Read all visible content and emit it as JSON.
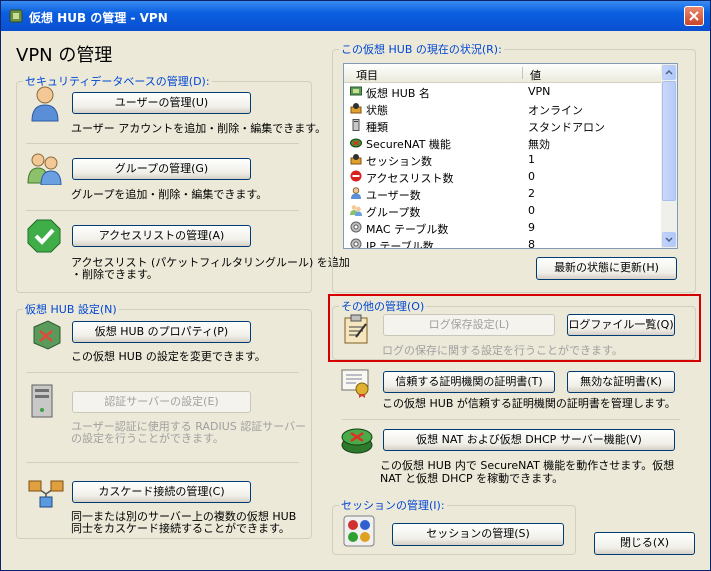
{
  "window": {
    "title": "仮想 HUB の管理 - VPN",
    "heading": "VPN の管理"
  },
  "security_db": {
    "legend": "セキュリティデータベースの管理(D):",
    "user_btn": "ユーザーの管理(U)",
    "user_desc": "ユーザー アカウントを追加・削除・編集できます。",
    "group_btn": "グループの管理(G)",
    "group_desc": "グループを追加・削除・編集できます。",
    "acl_btn": "アクセスリストの管理(A)",
    "acl_desc1": "アクセスリスト (パケットフィルタリングルール) を追加",
    "acl_desc2": "・削除できます。"
  },
  "hub_settings": {
    "legend": "仮想 HUB 設定(N)",
    "prop_btn": "仮想 HUB のプロパティ(P)",
    "prop_desc": "この仮想 HUB の設定を変更できます。",
    "radius_btn": "認証サーバーの設定(E)",
    "radius_desc1": "ユーザー認証に使用する RADIUS 認証サーバー",
    "radius_desc2": "の設定を行うことができます。",
    "cascade_btn": "カスケード接続の管理(C)",
    "cascade_desc1": "同一または別のサーバー上の複数の仮想 HUB",
    "cascade_desc2": "同士をカスケード接続することができます。"
  },
  "status": {
    "legend": "この仮想 HUB の現在の状況(R):",
    "col_item": "項目",
    "col_value": "値",
    "rows": [
      {
        "icon": "hub-icon",
        "item": "仮想 HUB 名",
        "value": "VPN"
      },
      {
        "icon": "status-icon",
        "item": "状態",
        "value": "オンライン"
      },
      {
        "icon": "server-type-icon",
        "item": "種類",
        "value": "スタンドアロン"
      },
      {
        "icon": "securenat-icon",
        "item": "SecureNAT 機能",
        "value": "無効"
      },
      {
        "icon": "session-icon",
        "item": "セッション数",
        "value": "1"
      },
      {
        "icon": "no-entry-icon",
        "item": "アクセスリスト数",
        "value": "0"
      },
      {
        "icon": "user-icon",
        "item": "ユーザー数",
        "value": "2"
      },
      {
        "icon": "group-icon",
        "item": "グループ数",
        "value": "0"
      },
      {
        "icon": "mac-table-icon",
        "item": "MAC テーブル数",
        "value": "9"
      },
      {
        "icon": "ip-table-icon",
        "item": "IP テーブル数",
        "value": "8"
      }
    ],
    "refresh_btn": "最新の状態に更新(H)"
  },
  "other": {
    "legend": "その他の管理(O)",
    "log_settings_btn": "ログ保存設定(L)",
    "log_list_btn": "ログファイル一覧(Q)",
    "log_desc": "ログの保存に関する設定を行うことができます。",
    "trusted_ca_btn": "信頼する証明機関の証明書(T)",
    "crl_btn": "無効な証明書(K)",
    "cert_desc": "この仮想 HUB が信頼する証明機関の証明書を管理します。",
    "nat_btn": "仮想 NAT および仮想 DHCP サーバー機能(V)",
    "nat_desc1": "この仮想 HUB 内で SecureNAT 機能を動作させます。仮想",
    "nat_desc2": "NAT と仮想 DHCP を稼動できます。"
  },
  "session": {
    "legend": "セッションの管理(I):",
    "btn": "セッションの管理(S)"
  },
  "close_btn": "閉じる(X)",
  "colors": {
    "accent": "#0046d5",
    "highlight": "#d40000",
    "title_bar": "#0a5fe0"
  }
}
